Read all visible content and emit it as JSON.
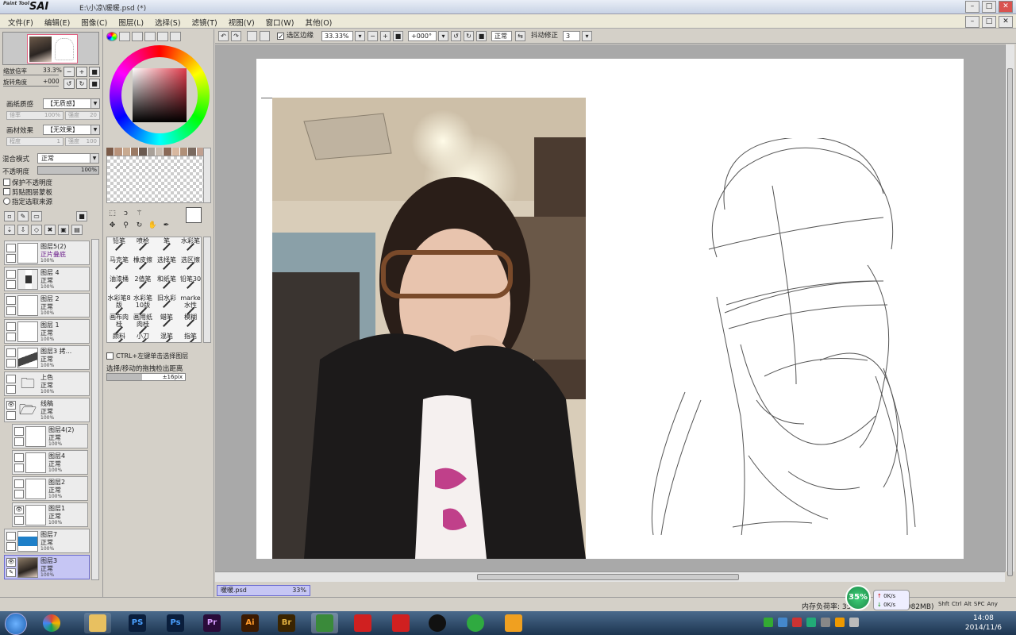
{
  "window": {
    "logo": "SAI",
    "logo_small": "Paint Tool",
    "title": "E:\\小凉\\暖暖.psd (*)"
  },
  "menu": [
    "文件(F)",
    "编辑(E)",
    "图像(C)",
    "图层(L)",
    "选择(S)",
    "滤镜(T)",
    "视图(V)",
    "窗口(W)",
    "其他(O)"
  ],
  "navigator": {
    "zoom_label": "缩放倍率",
    "zoom_value": "33.3%",
    "rotate_label": "旋转角度",
    "rotate_value": "+000"
  },
  "paper": {
    "texture_label": "画纸质感",
    "texture_value": "【无质感】",
    "scale_label": "倍率",
    "scale_value": "100%",
    "strength_label": "强度",
    "strength_value": "20",
    "effect_label": "画材效果",
    "effect_value": "【无效果】",
    "degree_label": "程度",
    "degree_value": "1",
    "strength2_label": "强度",
    "strength2_value": "100"
  },
  "blend": {
    "mode_label": "混合模式",
    "mode_value": "正常",
    "opacity_label": "不透明度",
    "opacity_value": "100%",
    "protect_opacity": "保护不透明度",
    "clip_group": "剪贴图层蒙板",
    "select_source": "指定选取来源"
  },
  "layers": [
    {
      "name": "图层5(2)",
      "mode": "正片叠底",
      "pct": "100%"
    },
    {
      "name": "图层 4",
      "mode": "正常",
      "pct": "100%"
    },
    {
      "name": "图层 2",
      "mode": "正常",
      "pct": "100%"
    },
    {
      "name": "图层 1",
      "mode": "正常",
      "pct": "100%"
    },
    {
      "name": "图层3 拷...",
      "mode": "正常",
      "pct": "100%"
    },
    {
      "name": "上色",
      "mode": "正常",
      "pct": "100%"
    },
    {
      "name": "线稿",
      "mode": "正常",
      "pct": "100%"
    },
    {
      "name": "图层4(2)",
      "mode": "正常",
      "pct": "100%"
    },
    {
      "name": "图层4",
      "mode": "正常",
      "pct": "100%"
    },
    {
      "name": "图层2",
      "mode": "正常",
      "pct": "100%"
    },
    {
      "name": "图层1",
      "mode": "正常",
      "pct": "100%"
    },
    {
      "name": "图层7",
      "mode": "正常",
      "pct": "100%"
    },
    {
      "name": "图层3",
      "mode": "正常",
      "pct": "100%"
    }
  ],
  "brushes": [
    "铅笔",
    "喷枪",
    "笔",
    "水彩笔",
    "马克笔",
    "橡皮擦",
    "选择笔",
    "选区擦",
    "油漆桶",
    "2值笔",
    "和纸笔",
    "铅笔30",
    "水彩笔8版",
    "水彩笔10版",
    "旧水彩",
    "marke水性",
    "画布肉桂",
    "画用纸肉桂",
    "蜡笔",
    "模糊",
    "颜料",
    "小刀",
    "混笔",
    "指笔"
  ],
  "options": {
    "ctrl_label": "CTRL+左键单击选择图层",
    "move_label": "选择/移动的拖拽检出距离",
    "move_value": "±16pix"
  },
  "toolbar": {
    "selection_edge": "选区边缘",
    "zoom": "33.33%",
    "rotation": "+000°",
    "mode": "正常",
    "stabilizer_label": "抖动修正",
    "stabilizer_value": "3"
  },
  "document_tab": {
    "name": "暖暖.psd",
    "zoom": "33%"
  },
  "status": {
    "memory": "内存负荷率: 35",
    "memory_tail": "(982MB)",
    "net_pct": "35%",
    "up": "0K/s",
    "down": "0K/s",
    "indicators": [
      "Shft",
      "Ctrl",
      "Alt",
      "SPC",
      "Any"
    ]
  },
  "taskbar": {
    "apps": [
      "PS",
      "Ps",
      "Pr",
      "Ai",
      "Br"
    ],
    "time": "14:08",
    "date": "2014/11/6"
  },
  "colors": {
    "selected_layer": "#c6c6f4",
    "photoshop": "#0a1e3c",
    "premiere": "#2a0c3a",
    "illustrator": "#3c1a00",
    "bridge": "#3a2400"
  }
}
